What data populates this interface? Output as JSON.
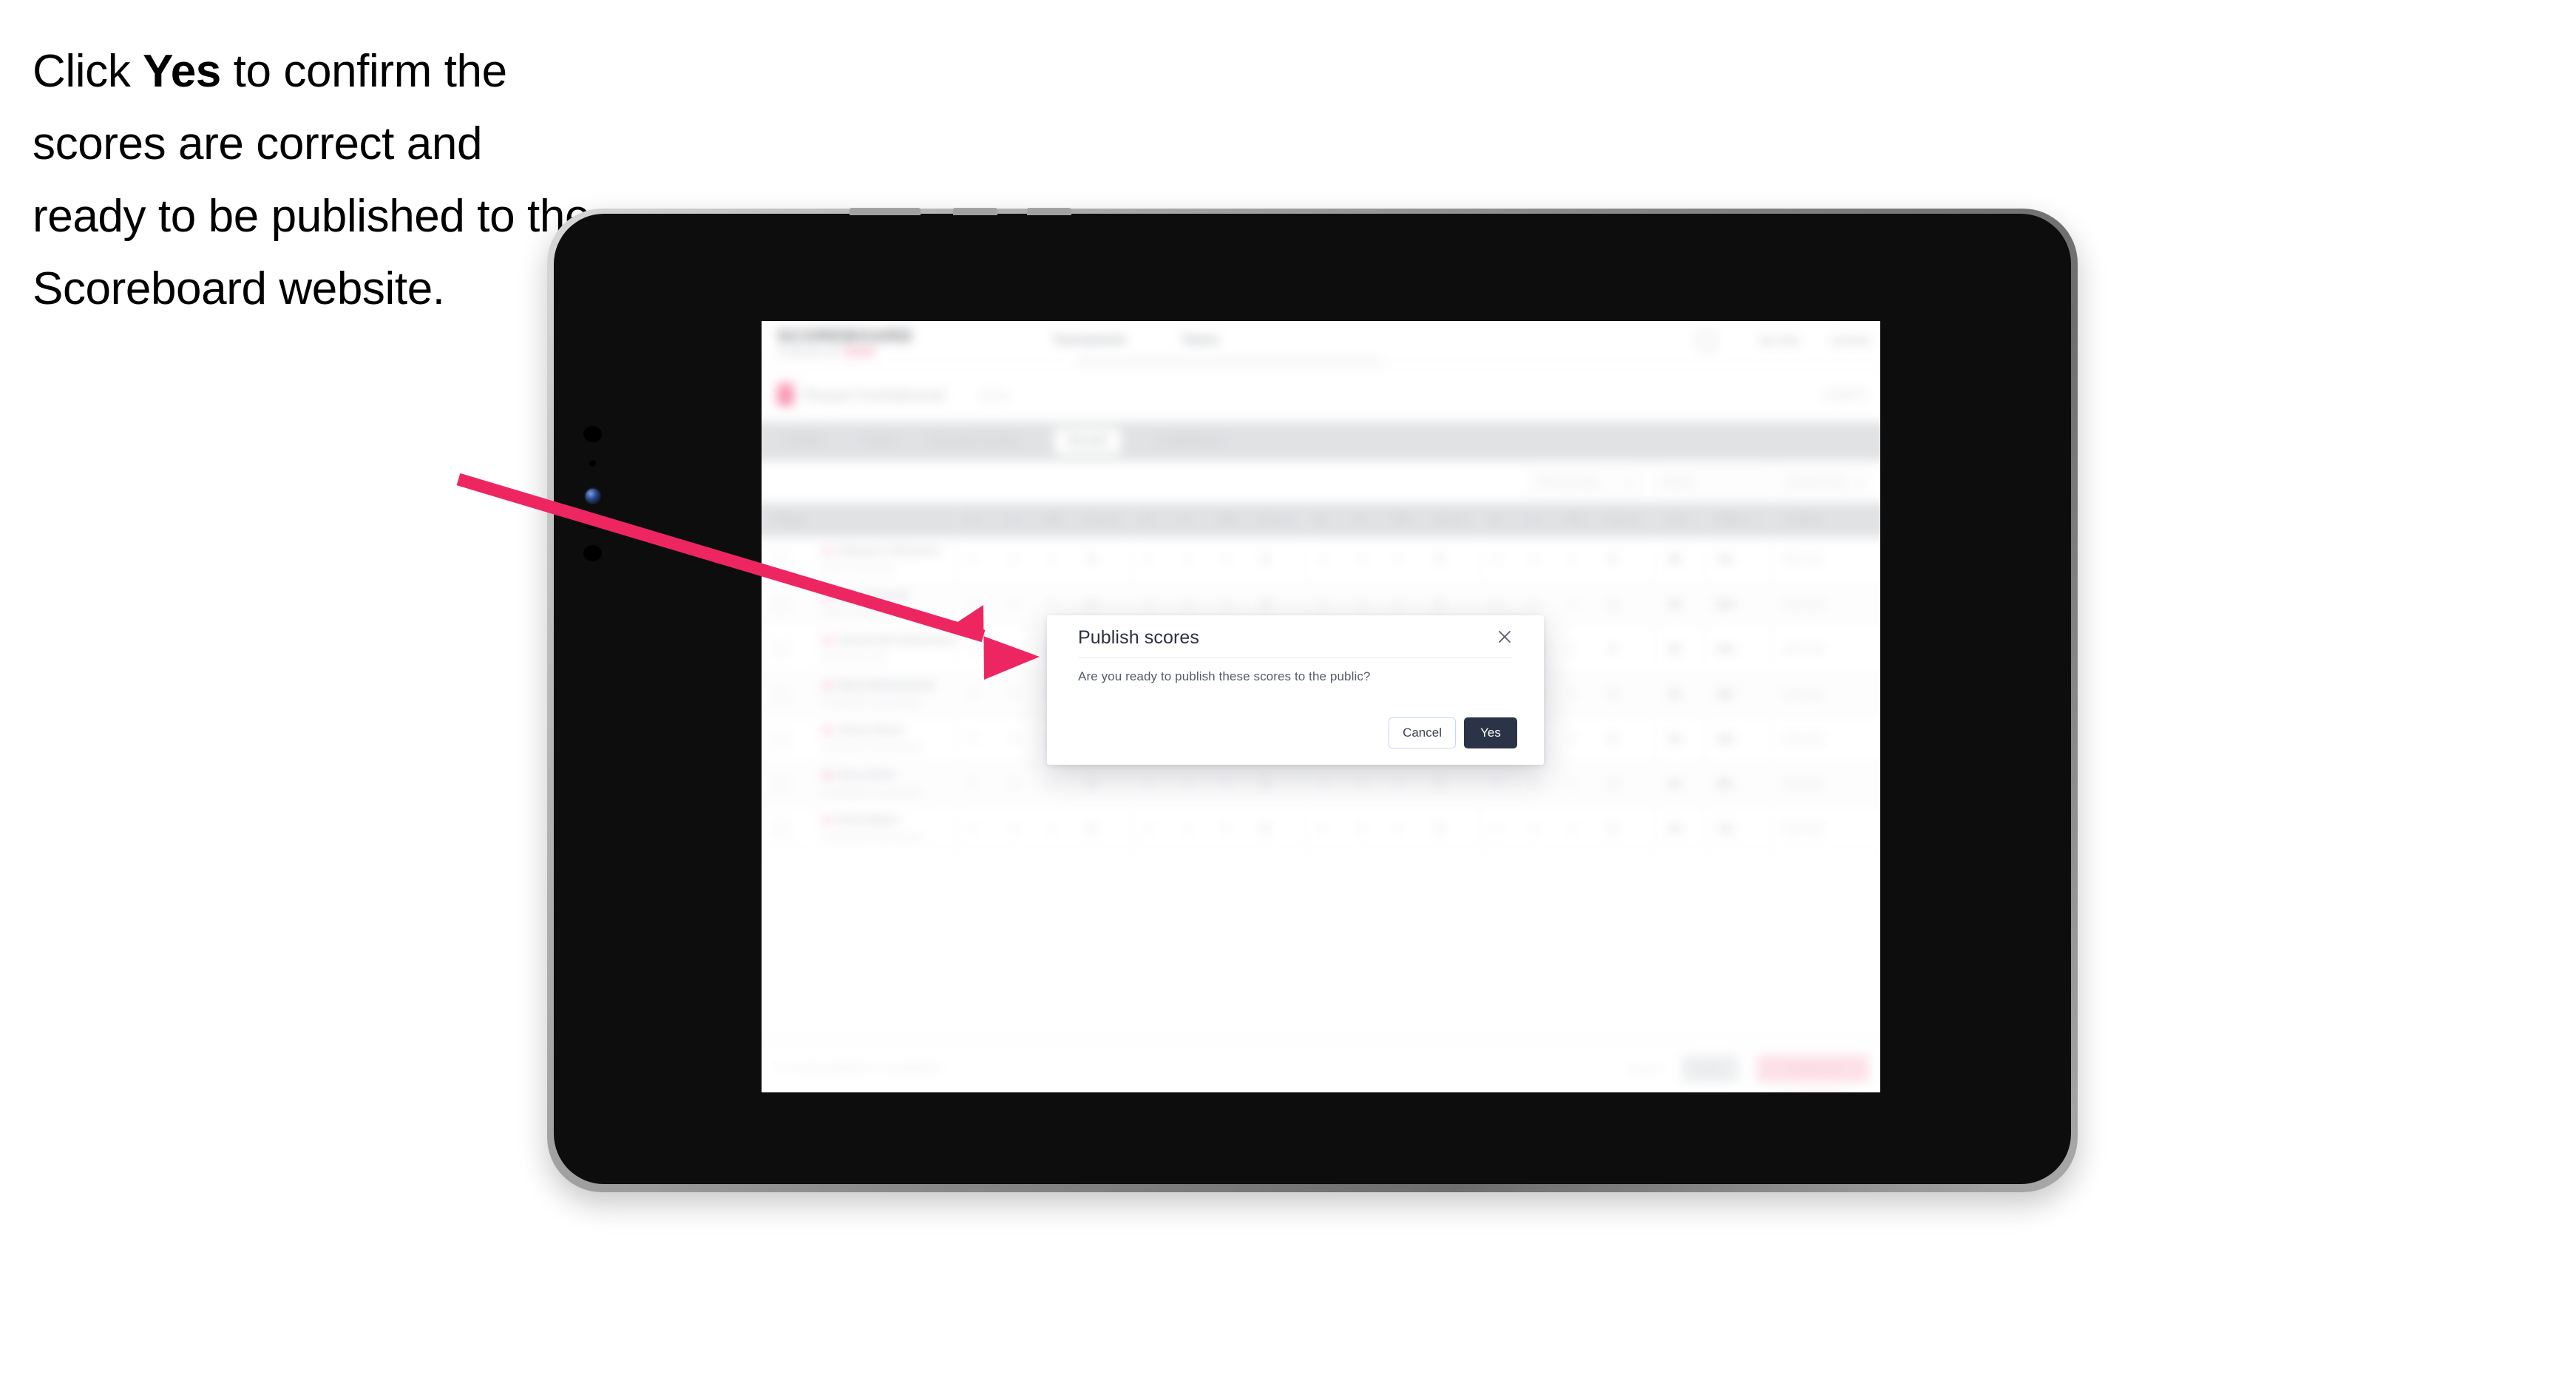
{
  "caption": {
    "before": "Click ",
    "emphasis": "Yes",
    "after": " to confirm the scores are correct and ready to be published to the Scoreboard website."
  },
  "colors": {
    "arrow": "#ED2661",
    "modal_primary_button": "#2B3446",
    "brand_pink": "#F0336A",
    "device_body": "#0D0D0D"
  },
  "modal": {
    "title": "Publish scores",
    "body": "Are you ready to publish these scores to the public?",
    "close_icon": "close-icon",
    "cancel_label": "Cancel",
    "confirm_label": "Yes"
  },
  "app": {
    "nav": {
      "wordmark": "SCOREBOARD",
      "subtitle_text": "POWERED BY ",
      "subtitle_brand": "SPORT",
      "links": [
        "Tournaments",
        "Teams"
      ],
      "center_pill": "",
      "account_name": "My Club",
      "account_menu": "Account"
    },
    "title_bar": {
      "title": "Royal Invitational",
      "subtitle": "2024",
      "right_label": "Level 3"
    },
    "tabs": [
      {
        "label": "Details",
        "active": false
      },
      {
        "label": "Teams",
        "active": false
      },
      {
        "label": "Gymnast Entries",
        "active": false
      },
      {
        "label": "Results",
        "active": true
      },
      {
        "label": "Leaderboard",
        "active": false
      }
    ],
    "filters": [
      {
        "label": "Filter by team",
        "caret": "▾"
      },
      {
        "label": "Search",
        "caret": ""
      },
      {
        "label": "Session One",
        "caret": "▾"
      }
    ],
    "table": {
      "columns": [
        "Player",
        "D",
        "E",
        "ND",
        "Score",
        "D",
        "E",
        "ND",
        "Score",
        "D",
        "E",
        "ND",
        "Score",
        "D",
        "E",
        "ND",
        "Score",
        "AA",
        "Place",
        "Action"
      ],
      "rows": [
        {
          "num": "01",
          "name": "Maelynn Edwards",
          "sub": "Royal Invitational",
          "cells": [
            "5",
            "8",
            "0",
            "9",
            "0",
            "0",
            "5",
            "8",
            "0",
            "8",
            "0",
            "5",
            "8",
            "8",
            "0",
            "0"
          ],
          "aa": "36",
          "place": "1st",
          "action": "Edit Add"
        },
        {
          "num": "02",
          "name": "Nina Parnell",
          "sub": "Royal Invitational",
          "cells": [
            "5",
            "8",
            "0",
            "9",
            "0",
            "0",
            "5",
            "8",
            "0",
            "8",
            "0",
            "5",
            "8",
            "8",
            "0",
            "0"
          ],
          "aa": "36",
          "place": "2nd",
          "action": "Edit Add"
        },
        {
          "num": "03",
          "name": "Savannah Robertson",
          "sub": "Riverside Gym",
          "cells": [
            "5",
            "8",
            "0",
            "9",
            "0",
            "0",
            "5",
            "8",
            "0",
            "8",
            "0",
            "5",
            "8",
            "8",
            "0",
            "0"
          ],
          "aa": "35",
          "place": "3rd",
          "action": "Edit Add"
        },
        {
          "num": "04",
          "name": "Nina Mohammed",
          "sub": "Southbank Gymnastics",
          "cells": [
            "5",
            "8",
            "0",
            "9",
            "0",
            "0",
            "5",
            "8",
            "0",
            "8",
            "0",
            "5",
            "8",
            "8",
            "0",
            "0"
          ],
          "aa": "35",
          "place": "4th",
          "action": "Edit Add"
        },
        {
          "num": "05",
          "name": "Alicia Nunn",
          "sub": "Southbank Gymnastics",
          "cells": [
            "5",
            "8",
            "0",
            "9",
            "0",
            "0",
            "5",
            "8",
            "0",
            "8",
            "0",
            "5",
            "8",
            "8",
            "0",
            "0"
          ],
          "aa": "34",
          "place": "5th",
          "action": "Edit Add"
        },
        {
          "num": "06",
          "name": "Nora Britt",
          "sub": "Southbank Gymnastics",
          "cells": [
            "5",
            "8",
            "0",
            "9",
            "0",
            "0",
            "5",
            "8",
            "0",
            "8",
            "0",
            "5",
            "8",
            "8",
            "0",
            "0"
          ],
          "aa": "34",
          "place": "6th",
          "action": "Edit Add"
        },
        {
          "num": "07",
          "name": "Britt Baker",
          "sub": "Southbank Gymnastics",
          "cells": [
            "5",
            "8",
            "0",
            "9",
            "0",
            "0",
            "5",
            "8",
            "0",
            "8",
            "0",
            "5",
            "8",
            "8",
            "0",
            "0"
          ],
          "aa": "33",
          "place": "7th",
          "action": "Edit Add"
        }
      ]
    },
    "footer": {
      "note": "No results published or unpublished",
      "link": "Cancel",
      "save_label": "Save",
      "publish_label": "Publish all unpublished"
    }
  }
}
